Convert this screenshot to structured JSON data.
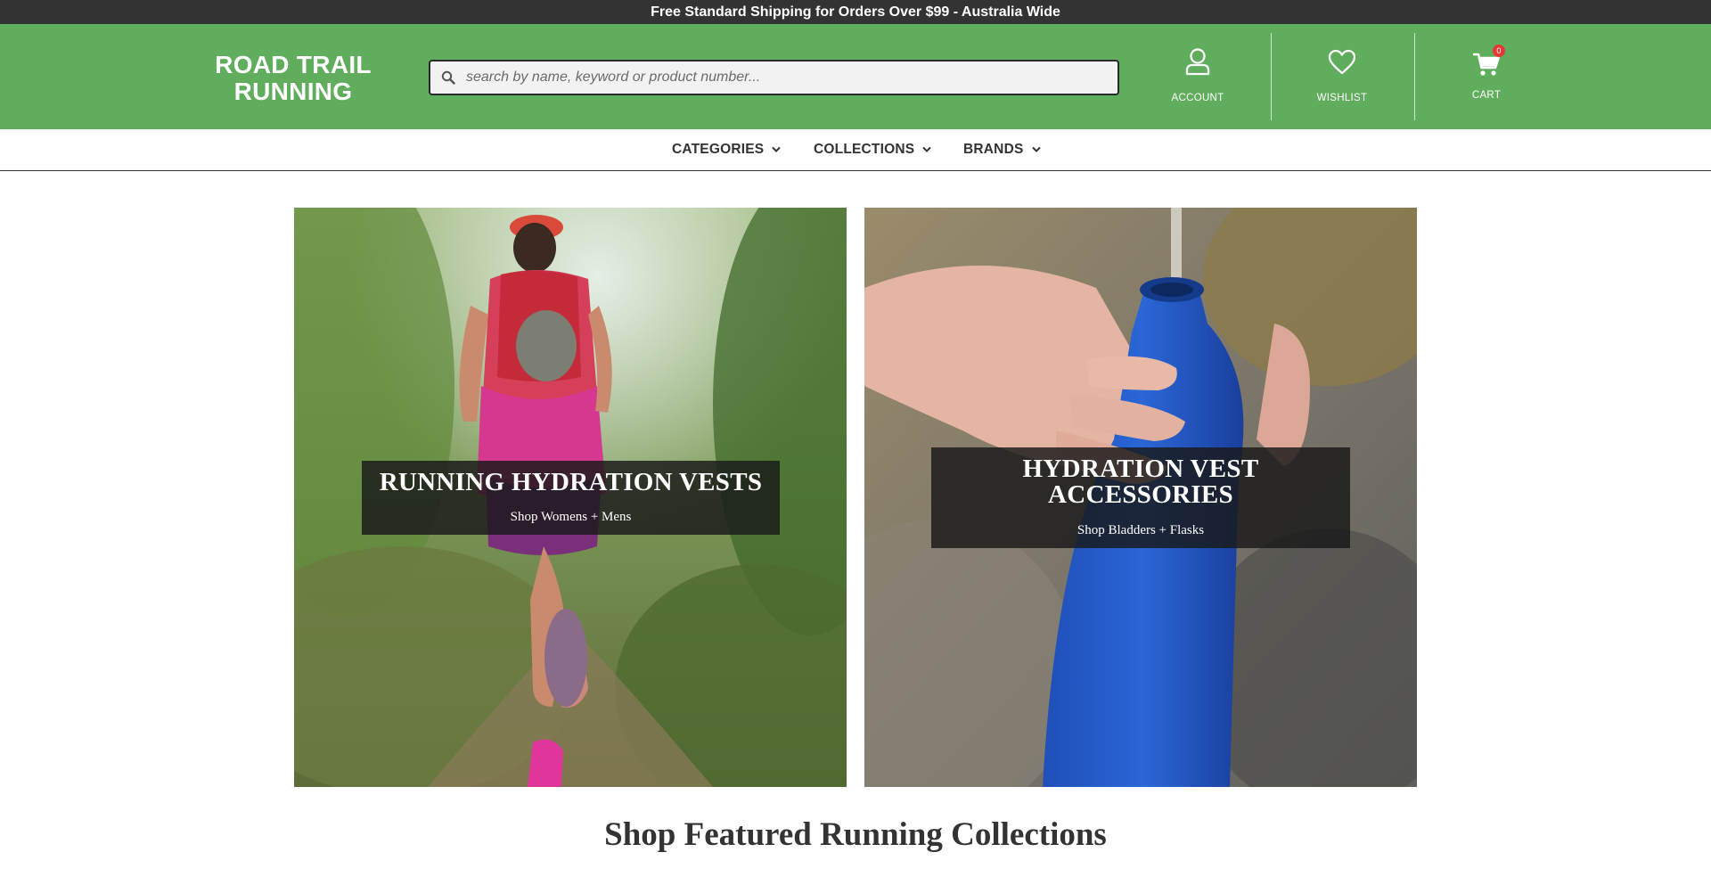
{
  "announcement": {
    "text": "Free Standard Shipping for Orders Over $99 - Australia Wide"
  },
  "header": {
    "logo_line1": "ROAD TRAIL",
    "logo_line2": "RUNNING",
    "search": {
      "placeholder": "search by name, keyword or product number...",
      "value": ""
    },
    "account_label": "ACCOUNT",
    "wishlist_label": "WISHLIST",
    "cart_label": "CART",
    "cart_count": "0",
    "icons": {
      "search": "search-icon",
      "account": "user-icon",
      "wishlist": "heart-icon",
      "cart": "cart-icon"
    }
  },
  "nav": {
    "items": [
      {
        "label": "CATEGORIES",
        "icon": "chevron-down-icon"
      },
      {
        "label": "COLLECTIONS",
        "icon": "chevron-down-icon"
      },
      {
        "label": "BRANDS",
        "icon": "chevron-down-icon"
      }
    ]
  },
  "promos": [
    {
      "title": "RUNNING HYDRATION VESTS",
      "subtitle": "Shop Womens + Mens"
    },
    {
      "title_line1": "HYDRATION VEST",
      "title_line2": "ACCESSORIES",
      "subtitle": "Shop Bladders + Flasks"
    }
  ],
  "section": {
    "title": "Shop Featured Running Collections"
  },
  "colors": {
    "header_green": "#60ad5e",
    "topbar": "#333333",
    "badge": "#e53935"
  }
}
